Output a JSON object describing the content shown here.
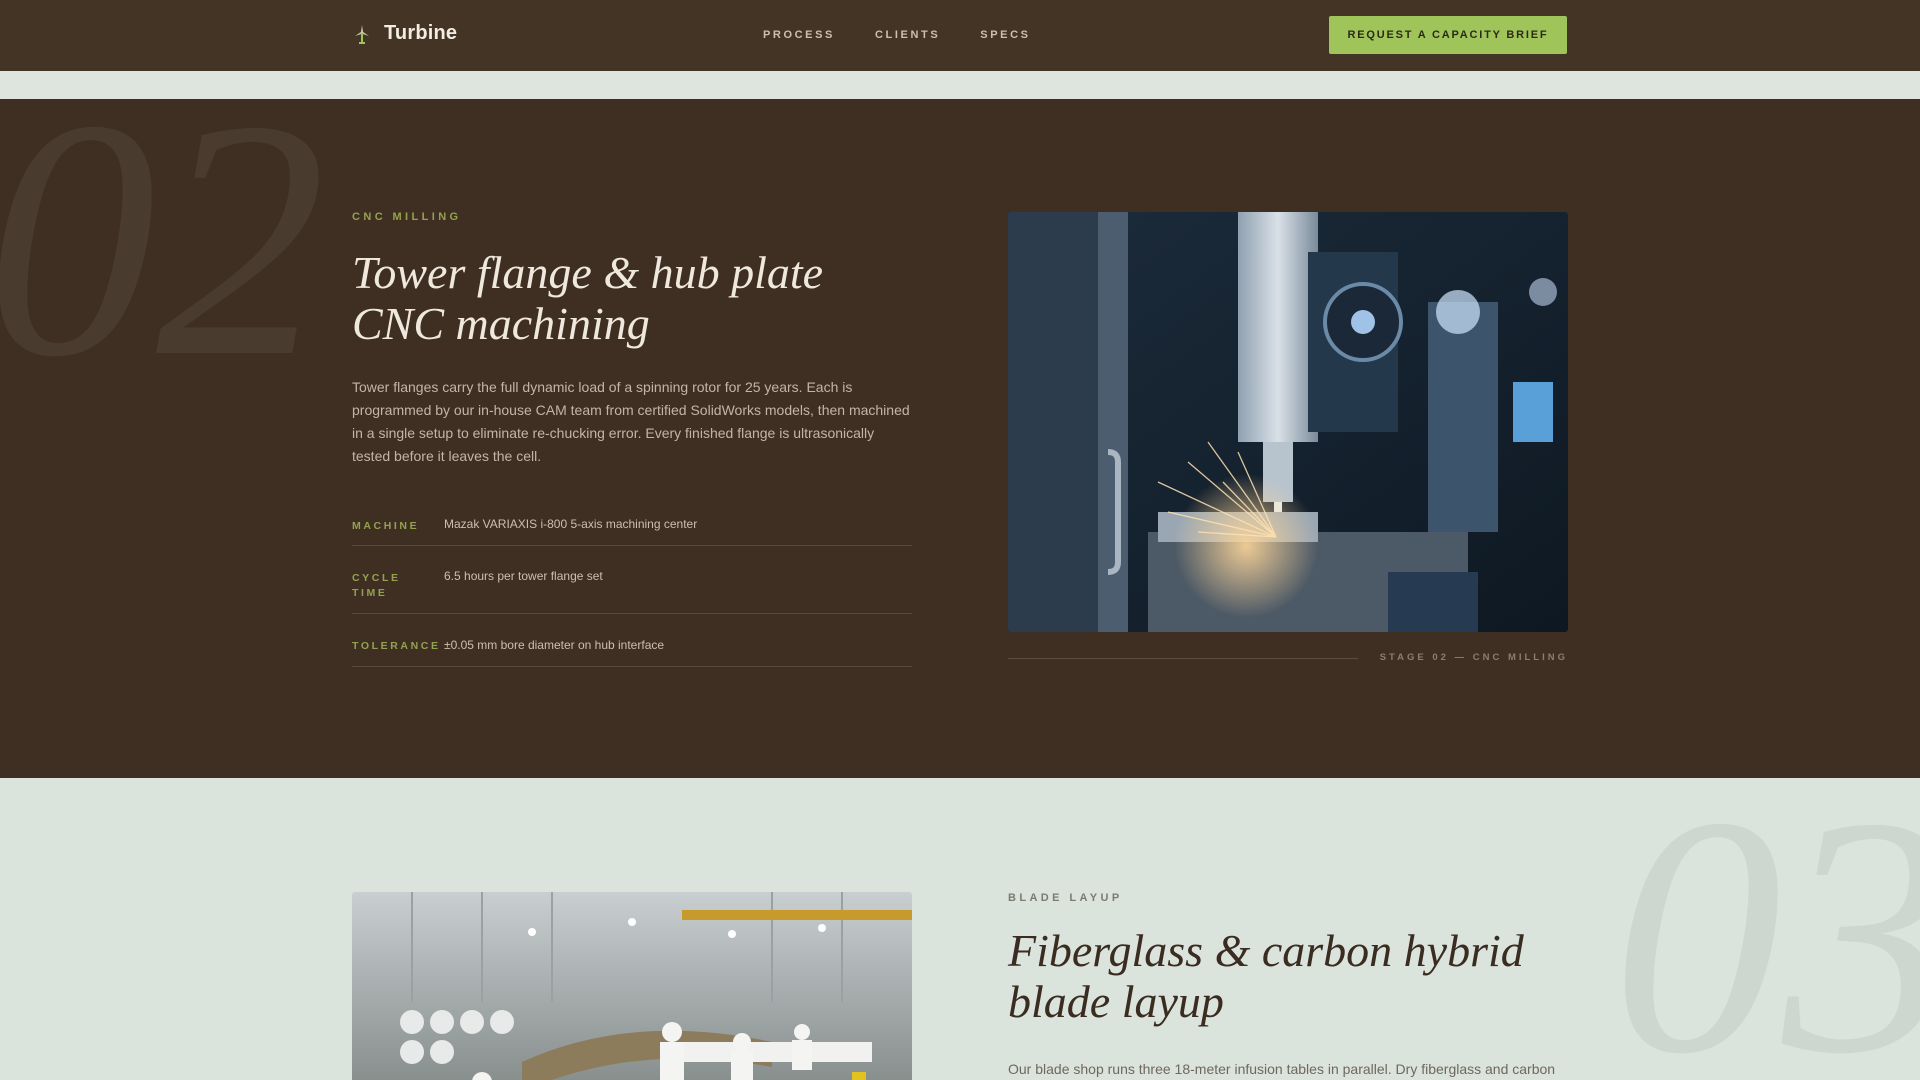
{
  "nav": {
    "brand": "Turbine",
    "links": [
      "PROCESS",
      "CLIENTS",
      "SPECS"
    ],
    "cta": "REQUEST A CAPACITY BRIEF"
  },
  "stage2": {
    "number": "02",
    "eyebrow": "CNC MILLING",
    "title_line1": "Tower flange & hub plate",
    "title_line2": "CNC machining",
    "body": "Tower flanges carry the full dynamic load of a spinning rotor for 25 years. Each is programmed by our in-house CAM team from certified SolidWorks models, then machined in a single setup to eliminate re-chucking error. Every finished flange is ultrasonically tested before it leaves the cell.",
    "specs": [
      {
        "key": "MACHINE",
        "value": "Mazak VARIAXIS i-800 5-axis machining center"
      },
      {
        "key": "CYCLE TIME",
        "value": "6.5 hours per tower flange set"
      },
      {
        "key": "TOLERANCE",
        "value": "±0.05 mm bore diameter on hub interface"
      }
    ],
    "caption": "STAGE 02 — CNC MILLING"
  },
  "stage3": {
    "number": "03",
    "eyebrow": "BLADE LAYUP",
    "title_line1": "Fiberglass & carbon hybrid",
    "title_line2": "blade layup",
    "body": "Our blade shop runs three 18-meter infusion tables in parallel. Dry fiberglass and carbon"
  },
  "colors": {
    "accent": "#9ec45a",
    "dark_bg": "#3f2f23",
    "light_bg": "#dae3dc"
  }
}
